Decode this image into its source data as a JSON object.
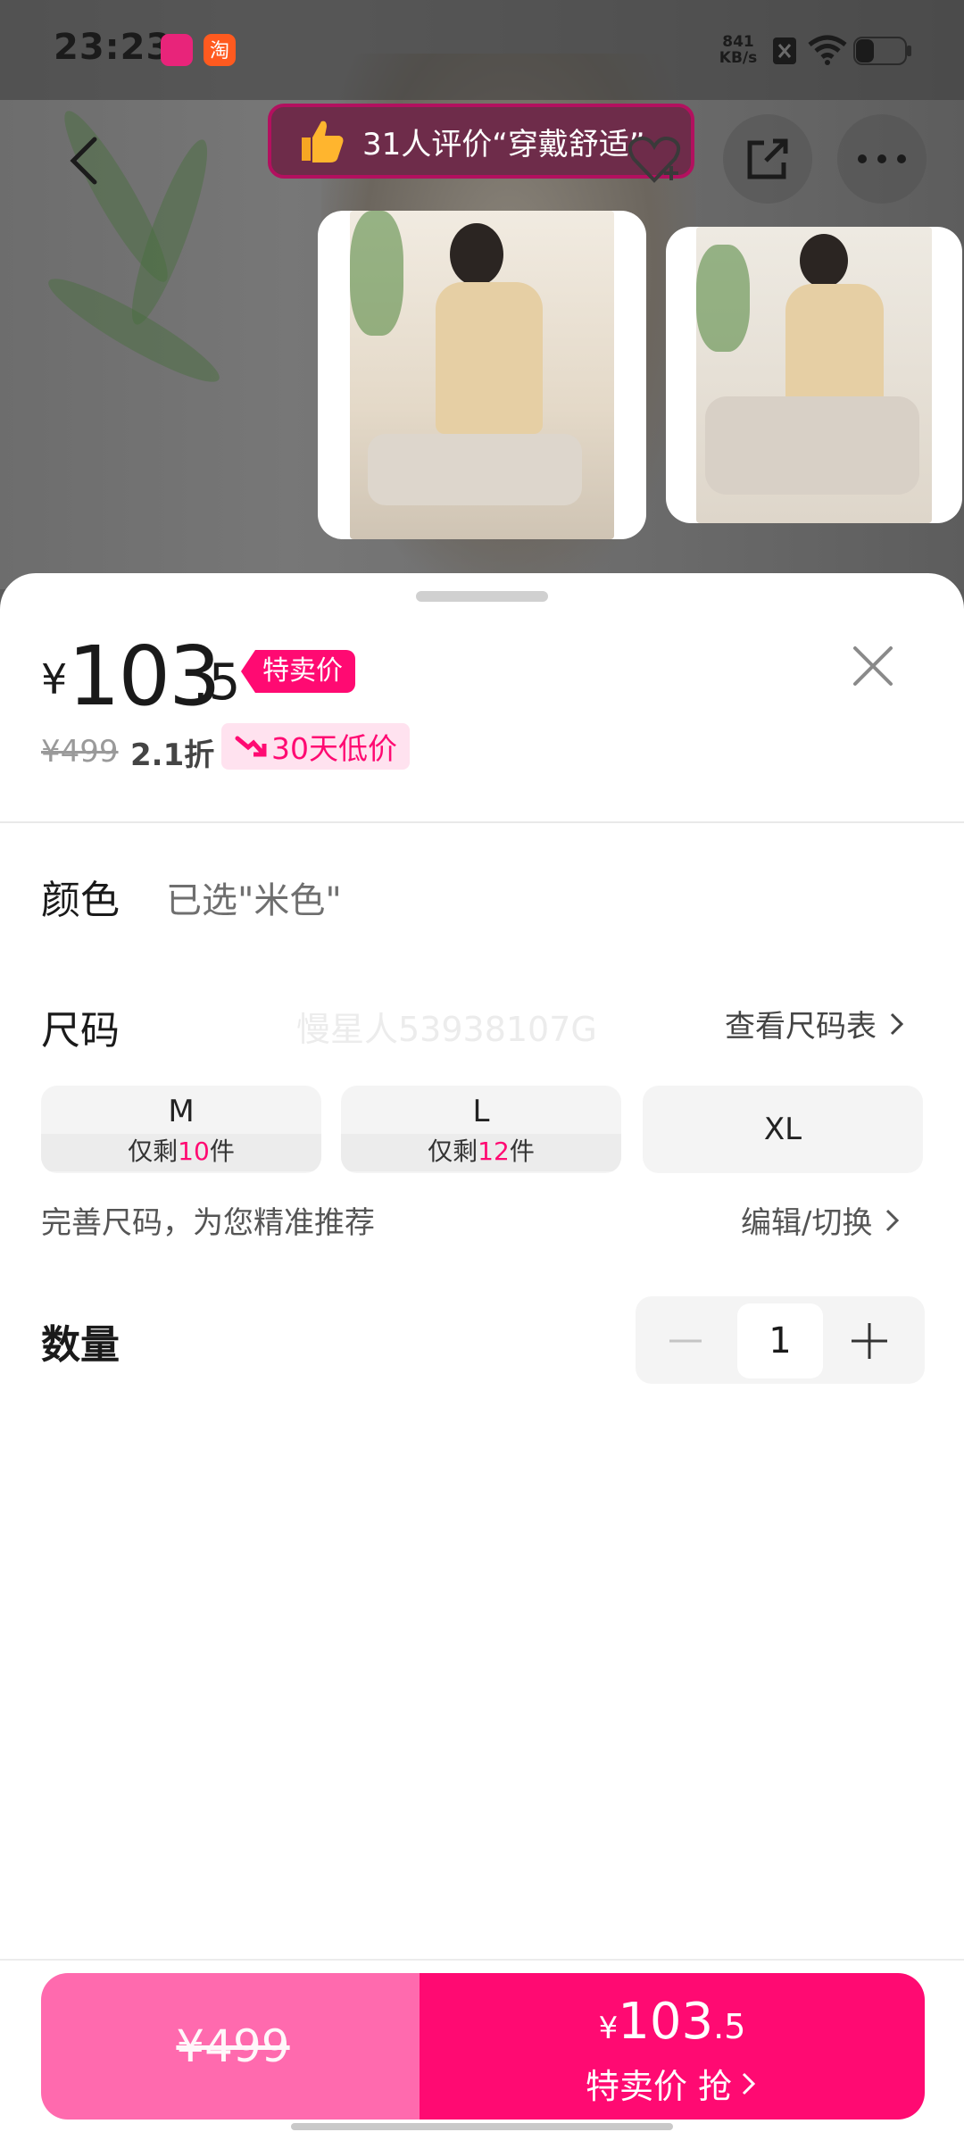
{
  "status_bar": {
    "time": "23:23",
    "net_speed_value": "841",
    "net_speed_unit": "KB/s",
    "icons": [
      "app-icon-vip",
      "app-icon-taobao",
      "no-sim-icon",
      "wifi-icon",
      "battery-icon"
    ]
  },
  "header": {
    "review_banner": "31人评价“穿戴舒适”",
    "icons": [
      "back-icon",
      "thumbs-up-icon",
      "share-icon",
      "more-icon"
    ]
  },
  "price": {
    "currency": "¥",
    "integer": "103",
    "decimal": ".5",
    "tag": "特卖价",
    "original": "¥499",
    "discount": "2.1折",
    "low_badge": "30天低价"
  },
  "color": {
    "title": "颜色",
    "selected": "已选\"米色\""
  },
  "size": {
    "title": "尺码",
    "watermark": "慢星人53938107G",
    "chart_link": "查看尺码表",
    "options": [
      {
        "name": "M",
        "stock_prefix": "仅剩",
        "stock_num": "10",
        "stock_suffix": "件"
      },
      {
        "name": "L",
        "stock_prefix": "仅剩",
        "stock_num": "12",
        "stock_suffix": "件"
      },
      {
        "name": "XL"
      }
    ],
    "hint": "完善尺码，为您精准推荐",
    "edit_link": "编辑/切换"
  },
  "quantity": {
    "title": "数量",
    "value": "1"
  },
  "bottom_bar": {
    "left_price": "¥499",
    "right_currency": "¥",
    "right_integer": "103",
    "right_decimal": ".5",
    "right_label": "特卖价 抢"
  },
  "colors": {
    "accent": "#ff0a72",
    "accent_light": "#ff6aae",
    "low_badge_bg": "#ffe2ef"
  }
}
